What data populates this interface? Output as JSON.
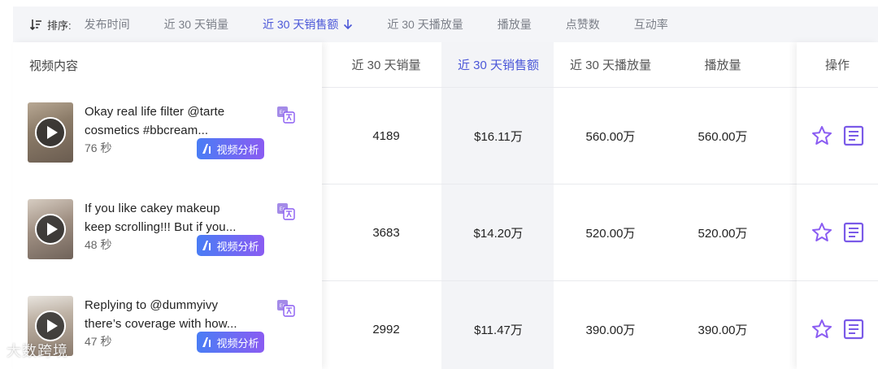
{
  "sortbar": {
    "label": "排序:",
    "options": [
      "发布时间",
      "近 30 天销量",
      "近 30 天销售额",
      "近 30 天播放量",
      "播放量",
      "点赞数",
      "互动率"
    ],
    "active_index": 2
  },
  "table": {
    "left_header": "视频内容",
    "columns": [
      "近 30 天销量",
      "近 30 天销售额",
      "近 30 天播放量",
      "播放量"
    ],
    "actions_header": "操作",
    "rows": [
      {
        "title_line1": "Okay real life filter      @tarte",
        "title_line2": "cosmetics #bbcream...",
        "duration": "76 秒",
        "analyze_label": "视频分析",
        "cells": [
          "4189",
          "$16.11万",
          "560.00万",
          "560.00万"
        ]
      },
      {
        "title_line1": "If you like cakey makeup",
        "title_line2": "keep scrolling!!! But if you...",
        "duration": "48 秒",
        "analyze_label": "视频分析",
        "cells": [
          "3683",
          "$14.20万",
          "520.00万",
          "520.00万"
        ]
      },
      {
        "title_line1": "Replying to @dummyivy",
        "title_line2": "there’s coverage with how...",
        "duration": "47 秒",
        "analyze_label": "视频分析",
        "cells": [
          "2992",
          "$11.47万",
          "390.00万",
          "390.00万"
        ]
      }
    ]
  },
  "watermark": "大数跨境",
  "colors": {
    "accent": "#4b57d8",
    "icon_purple": "#8a5cf2",
    "highlight_bg": "#f3f4f7"
  },
  "icons": [
    "sort-icon",
    "arrow-down-icon",
    "play-icon",
    "translate-icon",
    "ai-icon",
    "star-icon",
    "document-icon"
  ]
}
